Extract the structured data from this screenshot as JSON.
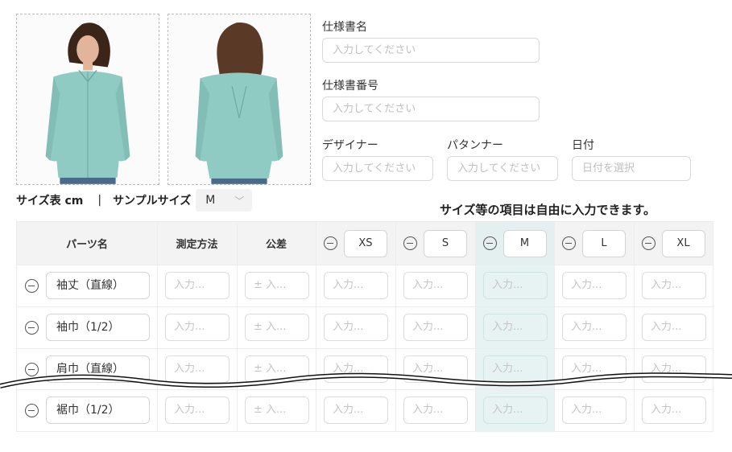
{
  "form": {
    "spec_name_label": "仕様書名",
    "spec_name_placeholder": "入力してください",
    "spec_number_label": "仕様書番号",
    "spec_number_placeholder": "入力してください",
    "designer_label": "デザイナー",
    "designer_placeholder": "入力してください",
    "patterner_label": "パタンナー",
    "patterner_placeholder": "入力してください",
    "date_label": "日付",
    "date_placeholder": "日付を選択"
  },
  "size_table_label": "サイズ表 cm",
  "separator": "|",
  "sample_size_label": "サンプルサイズ",
  "sample_size_value": "M",
  "note": "サイズ等の項目は自由に入力できます。",
  "table": {
    "headers": {
      "part": "パーツ名",
      "method": "測定方法",
      "tolerance": "公差"
    },
    "sizes": [
      "XS",
      "S",
      "M",
      "L",
      "XL"
    ],
    "highlighted_size": "M",
    "rows": [
      {
        "part": "袖丈（直線）"
      },
      {
        "part": "袖巾（1/2）"
      },
      {
        "part": "肩巾（直線）"
      },
      {
        "part": "裾巾（1/2）"
      }
    ],
    "cell_placeholder": "入力...",
    "tolerance_placeholder": "± 入..."
  },
  "colors": {
    "shirt": "#8fcbc3",
    "highlight": "#e6f3f2"
  }
}
